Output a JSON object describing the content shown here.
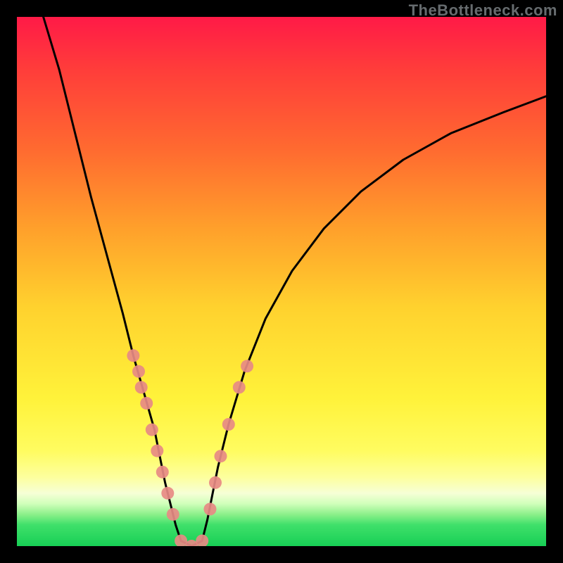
{
  "watermark": "TheBottleneck.com",
  "chart_data": {
    "type": "line",
    "title": "",
    "xlabel": "",
    "ylabel": "",
    "xlim": [
      0,
      100
    ],
    "ylim": [
      0,
      100
    ],
    "series": [
      {
        "name": "left-curve",
        "x": [
          5,
          8,
          11,
          14,
          17,
          20,
          22,
          24,
          26,
          27,
          28,
          29,
          30,
          31
        ],
        "y": [
          100,
          90,
          78,
          66,
          55,
          44,
          36,
          29,
          22,
          17,
          12,
          8,
          4,
          1
        ]
      },
      {
        "name": "bottom-curve",
        "x": [
          31,
          33,
          35
        ],
        "y": [
          1,
          0,
          1
        ]
      },
      {
        "name": "right-curve",
        "x": [
          35,
          36,
          37,
          38,
          40,
          43,
          47,
          52,
          58,
          65,
          73,
          82,
          92,
          100
        ],
        "y": [
          1,
          5,
          10,
          15,
          23,
          33,
          43,
          52,
          60,
          67,
          73,
          78,
          82,
          85
        ]
      }
    ],
    "markers": {
      "name": "pink-dots",
      "color": "#e78a84",
      "points_xy": [
        [
          22,
          36
        ],
        [
          23,
          33
        ],
        [
          23.5,
          30
        ],
        [
          24.5,
          27
        ],
        [
          25.5,
          22
        ],
        [
          26.5,
          18
        ],
        [
          27.5,
          14
        ],
        [
          28.5,
          10
        ],
        [
          29.5,
          6
        ],
        [
          31,
          1
        ],
        [
          33,
          0
        ],
        [
          35,
          1
        ],
        [
          36.5,
          7
        ],
        [
          37.5,
          12
        ],
        [
          38.5,
          17
        ],
        [
          40,
          23
        ],
        [
          42,
          30
        ],
        [
          43.5,
          34
        ]
      ]
    }
  }
}
